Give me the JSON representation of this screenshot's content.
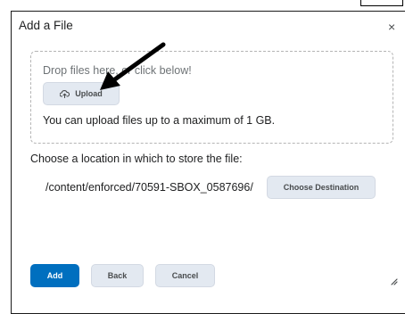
{
  "dialog": {
    "title": "Add a File",
    "close_glyph": "×"
  },
  "dropzone": {
    "hint": "Drop files here, or click below!",
    "upload_label": "Upload",
    "upload_icon": "cloud-upload-icon",
    "limit": "You can upload files up to a maximum of 1 GB."
  },
  "location": {
    "prompt": "Choose a location in which to store the file:",
    "path": "/content/enforced/70591-SBOX_0587696/",
    "choose_label": "Choose Destination"
  },
  "footer": {
    "add_label": "Add",
    "back_label": "Back",
    "cancel_label": "Cancel"
  },
  "colors": {
    "primary": "#006fbf",
    "secondary_bg": "#e3e9f1"
  }
}
